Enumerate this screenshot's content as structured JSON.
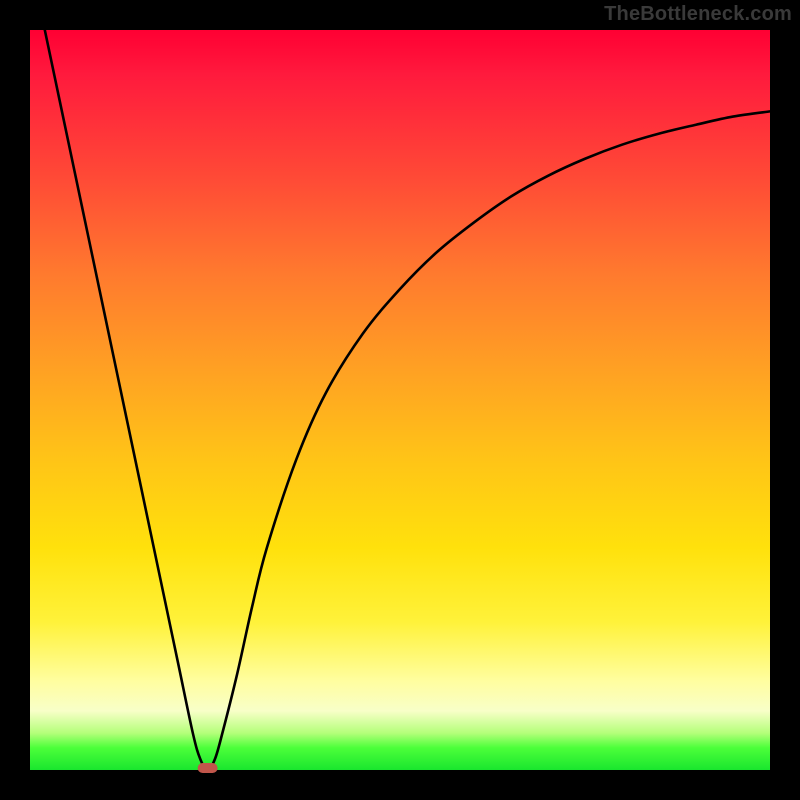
{
  "watermark": "TheBottleneck.com",
  "chart_data": {
    "type": "line",
    "title": "",
    "xlabel": "",
    "ylabel": "",
    "xlim": [
      0,
      100
    ],
    "ylim": [
      0,
      100
    ],
    "series": [
      {
        "name": "curve",
        "x": [
          2,
          4,
          6,
          8,
          10,
          12,
          14,
          16,
          18,
          20,
          22,
          23,
          24,
          25,
          26,
          28,
          30,
          32,
          36,
          40,
          45,
          50,
          55,
          60,
          65,
          70,
          75,
          80,
          85,
          90,
          95,
          100
        ],
        "y": [
          100,
          90.5,
          81,
          71.5,
          62,
          52.5,
          43,
          33.5,
          24,
          14.5,
          5,
          1.5,
          0,
          1.5,
          5,
          13,
          22,
          30,
          42,
          51,
          59,
          65,
          70,
          74,
          77.5,
          80.3,
          82.6,
          84.5,
          86,
          87.2,
          88.3,
          89
        ]
      }
    ],
    "marker": {
      "x": 24,
      "y": 0,
      "shape": "pill",
      "color": "#c1564b"
    },
    "background_gradient": {
      "top": "#ff0033",
      "mid": "#ffe10c",
      "bottom": "#19e62e"
    }
  }
}
